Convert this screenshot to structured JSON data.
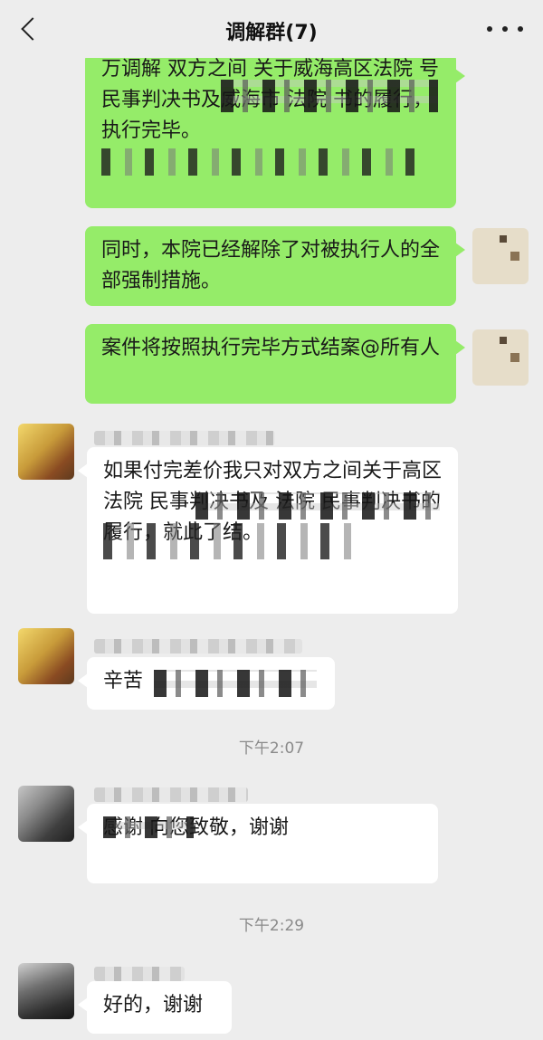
{
  "header": {
    "title": "调解群(7)",
    "back_icon": "chevron-left-icon",
    "more_icon": "more-dots-icon"
  },
  "messages": [
    {
      "side": "me",
      "text": "万调解 双方之间 关于威海高区法院 号民事判决书及威海市 法院 书的履行，执行完毕。"
    },
    {
      "side": "me",
      "text": "同时，本院已经解除了对被执行人的全部强制措施。"
    },
    {
      "side": "me",
      "text": "案件将按照执行完毕方式结案@所有人"
    },
    {
      "side": "other",
      "text": "如果付完差价我只对双方之间关于高区法院 民事判决书及 法院 民事判决书的履行，就此了结。"
    },
    {
      "side": "other",
      "text": "辛苦"
    },
    {
      "side": "other",
      "text": "感谢 向您致敬，谢谢"
    },
    {
      "side": "other",
      "text": "好的，谢谢"
    }
  ],
  "timestamps": [
    "下午2:07",
    "下午2:29"
  ],
  "colors": {
    "background": "#ededed",
    "self_bubble": "#95ec69",
    "other_bubble": "#ffffff",
    "timestamp": "#8a8a8a"
  }
}
